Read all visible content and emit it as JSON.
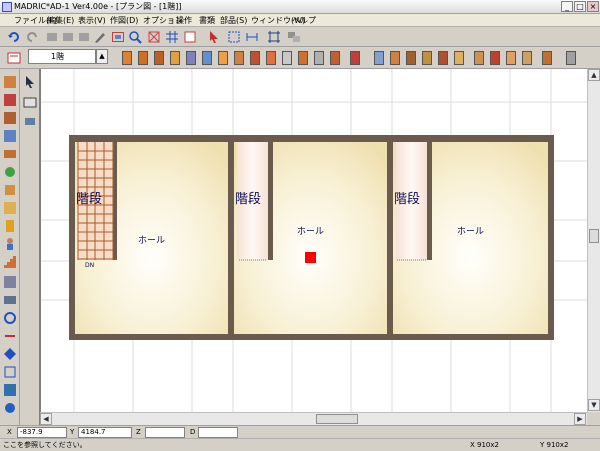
{
  "window": {
    "title": "MADRIC*AD-1 Ver4.00e - [プラン図 - [1階]]",
    "min_label": "_",
    "max_label": "□",
    "close_label": "×"
  },
  "menubar": {
    "items": [
      "ファイル(F)",
      "編集(E)",
      "表示(V)",
      "作図(D)",
      "オプション",
      "操作",
      "書類",
      "部品(S)",
      "ウィンドウ(W)",
      "ヘルプ"
    ]
  },
  "floor_select": {
    "value": "1階",
    "arrow": "▲"
  },
  "plan": {
    "rooms": [
      {
        "stair_label": "階段",
        "hall_label": "ホール",
        "door_label": "DN"
      },
      {
        "stair_label": "階段",
        "hall_label": "ホール",
        "door_label": ""
      },
      {
        "stair_label": "階段",
        "hall_label": "ホール",
        "door_label": ""
      }
    ]
  },
  "coords": {
    "x_label": "X",
    "x_value": "-837.9",
    "y_label": "Y",
    "y_value": "4184.7",
    "z_label": "Z",
    "z_value": "",
    "d_label": "D",
    "d_value": ""
  },
  "status": {
    "message": "ここを参照してください。",
    "grid1": "X 910x2",
    "grid2": "Y 910x2"
  },
  "colors": {
    "wall": "#6b5a4e",
    "floor": "#f4ecc8",
    "stair_wood": "#a65a2a",
    "marker": "#ff0000",
    "grid": "#d8d8d8"
  }
}
